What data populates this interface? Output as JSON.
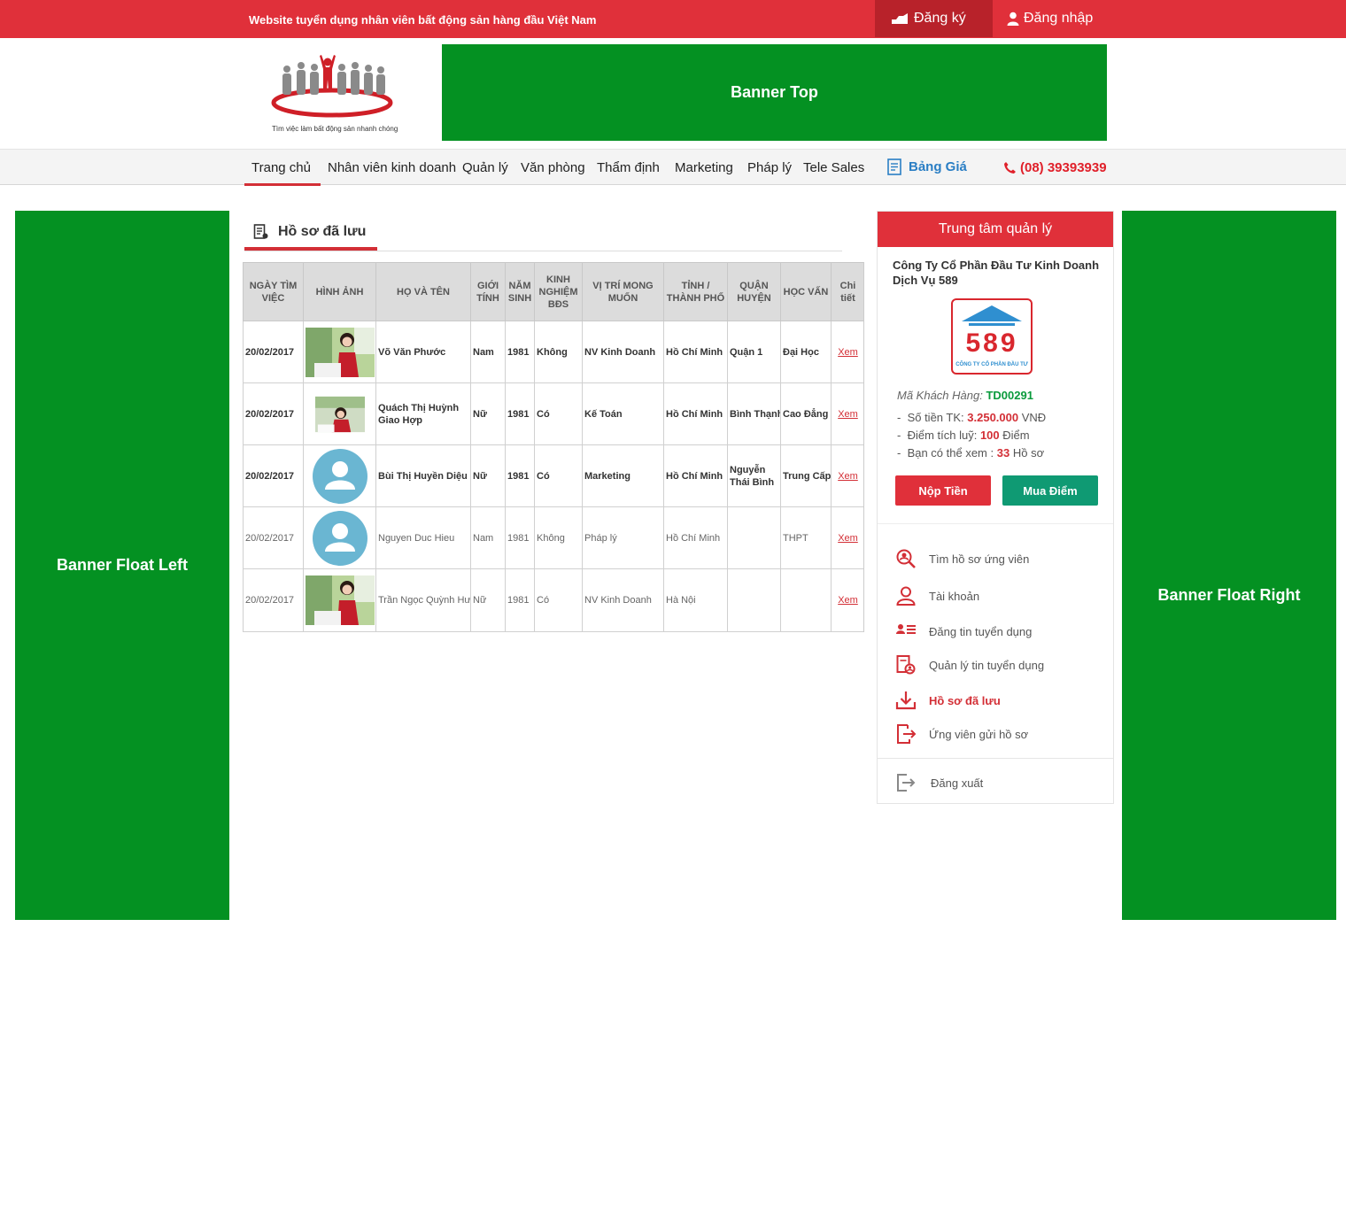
{
  "topbar": {
    "slogan": "Website tuyển dụng nhân viên bất động sản hàng đầu Việt Nam",
    "register": "Đăng ký",
    "login": "Đăng nhập"
  },
  "header": {
    "logo_tagline": "Tìm việc làm bất động sản nhanh chóng",
    "banner_top": "Banner Top"
  },
  "nav": {
    "items": [
      "Trang chủ",
      "Nhân viên kinh doanh",
      "Quản lý",
      "Văn phòng",
      "Thẩm định",
      "Marketing",
      "Pháp lý",
      "Tele Sales"
    ],
    "price": "Bảng Giá",
    "phone": "(08) 39393939"
  },
  "banners": {
    "left": "Banner Float Left",
    "right": "Banner Float  Right"
  },
  "section": {
    "title": "Hồ sơ đã lưu"
  },
  "table": {
    "headers": [
      "NGÀY TÌM VIỆC",
      "HÌNH ẢNH",
      "HỌ VÀ TÊN",
      "GIỚI TÍNH",
      "NĂM SINH",
      "KINH NGHIỆM BĐS",
      "VỊ TRÍ MONG MUỐN",
      "TỈNH / THÀNH PHỐ",
      "QUẬN HUYỆN",
      "HỌC VẤN",
      "Chi tiết"
    ],
    "rows": [
      {
        "date": "20/02/2017",
        "name": "Võ Văn Phước",
        "gender": "Nam",
        "year": "1981",
        "exp": "Không",
        "position": "NV Kinh Doanh",
        "city": "Hồ Chí Minh",
        "district": "Quận 1",
        "edu": "Đại Học",
        "detail": "Xem"
      },
      {
        "date": "20/02/2017",
        "name": "Quách Thị Huỳnh Giao Hợp",
        "gender": "Nữ",
        "year": "1981",
        "exp": "Có",
        "position": "Kế Toán",
        "city": "Hồ Chí Minh",
        "district": "Bình Thạnh",
        "edu": "Cao Đẳng",
        "detail": "Xem"
      },
      {
        "date": "20/02/2017",
        "name": "Bùi Thị Huyền Diệu",
        "gender": "Nữ",
        "year": "1981",
        "exp": "Có",
        "position": "Marketing",
        "city": "Hồ Chí Minh",
        "district": "Nguyễn Thái Bình",
        "edu": "Trung Cấp",
        "detail": "Xem"
      },
      {
        "date": "20/02/2017",
        "name": "Nguyen Duc Hieu",
        "gender": "Nam",
        "year": "1981",
        "exp": "Không",
        "position": "Pháp lý",
        "city": "Hồ Chí Minh",
        "district": "",
        "edu": "THPT",
        "detail": "Xem"
      },
      {
        "date": "20/02/2017",
        "name": "Trần Ngọc Quỳnh Hương",
        "gender": "Nữ",
        "year": "1981",
        "exp": "Có",
        "position": "NV Kinh Doanh",
        "city": "Hà Nội",
        "district": "",
        "edu": "",
        "detail": "Xem"
      }
    ]
  },
  "panel": {
    "title": "Trung tâm quản lý",
    "company": "Công Ty Cổ Phần Đầu Tư Kinh Doanh Dịch Vụ 589",
    "company_logo_text": "589",
    "company_logo_sub": "CÔNG TY CỔ PHẦN ĐẦU TƯ",
    "customer_code_label": "Mã Khách Hàng:",
    "customer_code": "TD00291",
    "balance_label": "Số tiền TK:",
    "balance_value": "3.250.000",
    "balance_unit": "VNĐ",
    "points_label": "Điểm tích luỹ:",
    "points_value": "100",
    "points_unit": "Điểm",
    "view_label": "Bạn có thể xem :",
    "view_value": "33",
    "view_unit": "Hồ sơ",
    "btn_deposit": "Nộp Tiền",
    "btn_buy": "Mua Điểm",
    "menu": [
      "Tìm hồ sơ ứng viên",
      "Tài khoản",
      "Đăng tin tuyển dụng",
      "Quản lý tin tuyển dụng",
      "Hồ sơ đã lưu",
      "Ứng viên gửi hồ sơ"
    ],
    "logout": "Đăng xuất"
  }
}
